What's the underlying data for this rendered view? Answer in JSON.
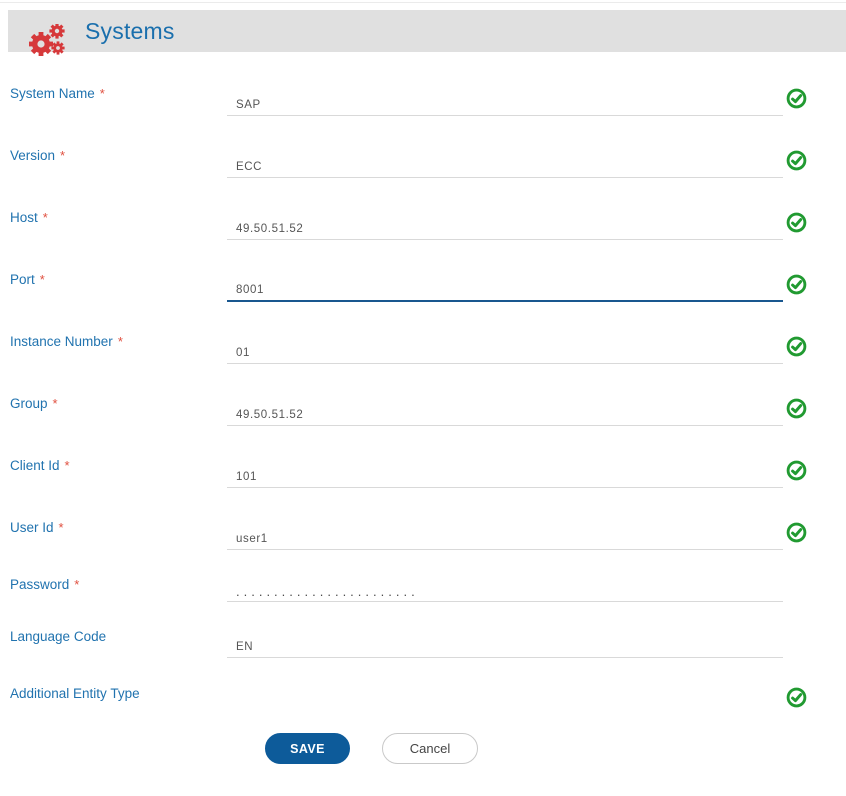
{
  "header": {
    "title": "Systems",
    "icon": "gears-icon",
    "bar_color": "#e0e0e0",
    "title_color": "#1a6fad",
    "icon_color": "#d6393b"
  },
  "fields": [
    {
      "label": "System Name",
      "star": "*",
      "value": "SAP",
      "checked": true
    },
    {
      "label": "Version",
      "star": "*",
      "value": "ECC",
      "checked": true
    },
    {
      "label": "Host",
      "star": "*",
      "value": "49.50.51.52",
      "checked": true
    },
    {
      "label": "Port",
      "star": "*",
      "value": "8001",
      "checked": true,
      "focused": true
    },
    {
      "label": "Instance Number",
      "star": "*",
      "value": "01",
      "checked": true
    },
    {
      "label": "Group",
      "star": "*",
      "value": "49.50.51.52",
      "checked": true
    },
    {
      "label": "Client Id",
      "star": "*",
      "value": "101",
      "checked": true
    },
    {
      "label": "User Id",
      "star": "*",
      "value": "user1",
      "checked": true
    },
    {
      "label": "Password",
      "star": "*",
      "value": "........................",
      "masked": true,
      "checked": false
    },
    {
      "label": "Language Code",
      "value": "EN",
      "checked": false
    },
    {
      "label": "Additional Entity Type",
      "value": "",
      "checked": true
    }
  ],
  "buttons": {
    "save": "SAVE",
    "cancel": "Cancel",
    "save_color": "#0d5b9a"
  },
  "colors": {
    "label_blue": "#2173af",
    "required_red": "#e04f3f",
    "check_green": "#219a31",
    "underline_gray": "#d9d9d9",
    "focused_underline_blue": "#19578f",
    "value_gray": "#555555"
  }
}
